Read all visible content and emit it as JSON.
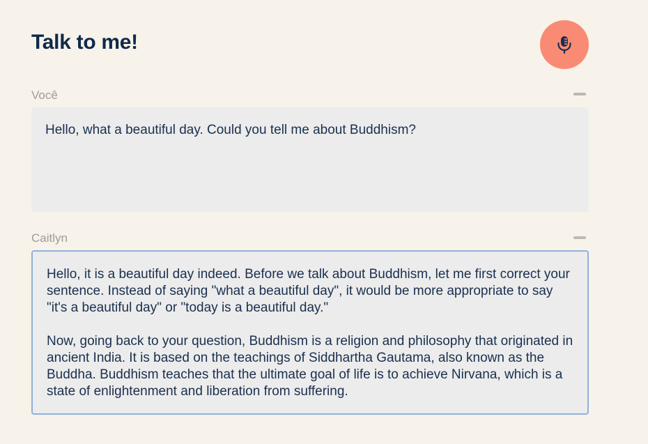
{
  "header": {
    "title": "Talk to me!",
    "mic_icon": "microphone-icon",
    "mic_color": "#f98b74"
  },
  "conversation": {
    "user": {
      "label": "Você",
      "text": "Hello, what a beautiful day. Could you tell me about Buddhism?"
    },
    "assistant": {
      "label": "Caitlyn",
      "paragraphs": [
        "Hello, it is a beautiful day indeed. Before we talk about Buddhism, let me first correct your sentence. Instead of saying \"what a beautiful day\", it would be more appropriate to say \"it's a beautiful day\" or \"today is a beautiful day.\"",
        "Now, going back to your question, Buddhism is a religion and philosophy that originated in ancient India. It is based on the teachings of Siddhartha Gautama, also known as the Buddha. Buddhism teaches that the ultimate goal of life is to achieve Nirvana, which is a state of enlightenment and liberation from suffering."
      ]
    }
  },
  "colors": {
    "background": "#f7f3ea",
    "title": "#0f2a4a",
    "text": "#1a2f4f",
    "label": "#a09c96",
    "box": "#ececec",
    "focus_border": "#8fb0dc"
  }
}
